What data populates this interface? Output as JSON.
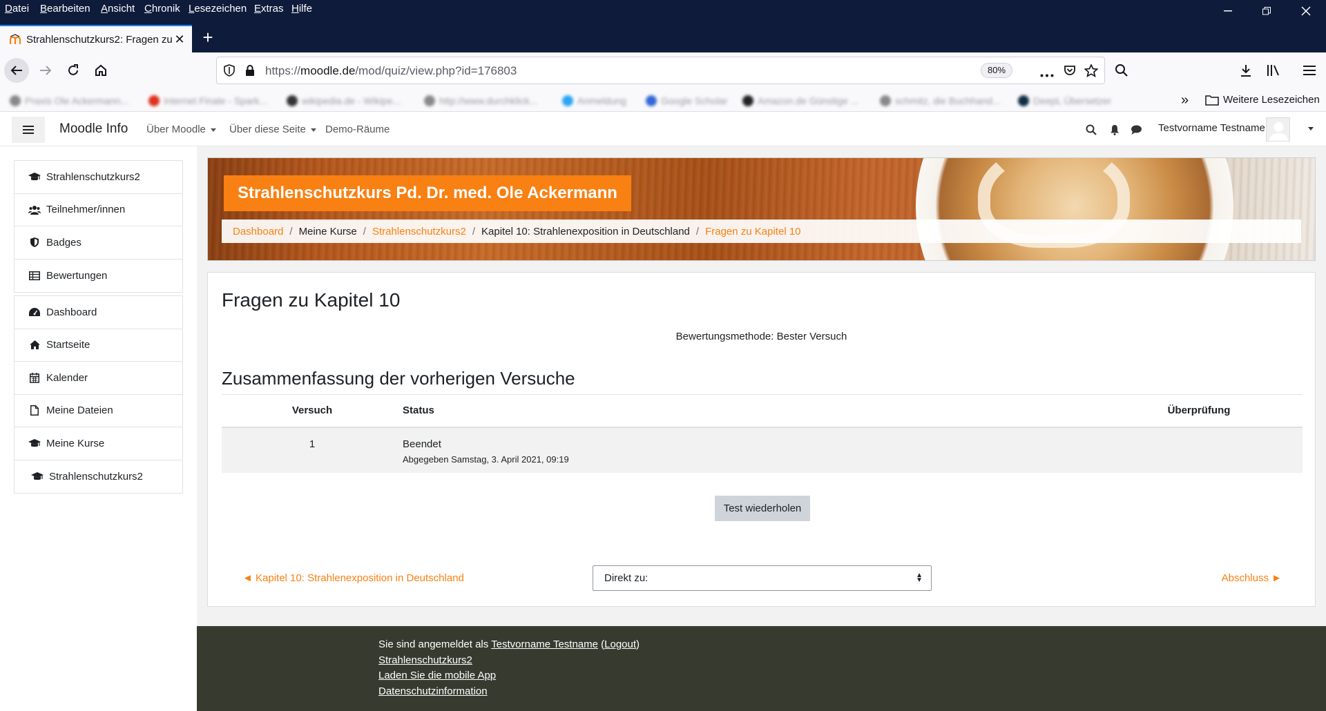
{
  "browser": {
    "menu": [
      "Datei",
      "Bearbeiten",
      "Ansicht",
      "Chronik",
      "Lesezeichen",
      "Extras",
      "Hilfe"
    ],
    "tab_title": "Strahlenschutzkurs2: Fragen zu Kapitel 10",
    "url_prefix": "https://",
    "url_host": "moodle.de",
    "url_path": "/mod/quiz/view.php?id=176803",
    "zoom": "80%",
    "bookmarks": [
      "Praxis Ole Ackermann...",
      "Internet Finale - Spark...",
      "wikipedia.de - Wikipe...",
      "http://www.durchklick...",
      "Anmeldung",
      "Google Scholar",
      "Amazon.de Günstige ...",
      "schmitz, die Buchhand...",
      "DeepL Übersetzer"
    ],
    "bookmarks_more": "Weitere Lesezeichen"
  },
  "moodle_nav": {
    "site_name": "Moodle Info",
    "menu1": "Über Moodle",
    "menu2": "Über diese Seite",
    "menu3": "Demo-Räume",
    "user": "Testvorname Testname"
  },
  "drawer": {
    "group1": [
      "Strahlenschutzkurs2",
      "Teilnehmer/innen",
      "Badges",
      "Bewertungen"
    ],
    "group2": [
      "Dashboard",
      "Startseite",
      "Kalender",
      "Meine Dateien",
      "Meine Kurse",
      "Strahlenschutzkurs2"
    ]
  },
  "header": {
    "course_title": "Strahlenschutzkurs Pd. Dr. med. Ole Ackermann",
    "breadcrumb": [
      "Dashboard",
      "Meine Kurse",
      "Strahlenschutzkurs2",
      "Kapitel 10: Strahlenexposition in Deutschland",
      "Fragen zu Kapitel 10"
    ]
  },
  "main": {
    "title": "Fragen zu Kapitel 10",
    "grading_method": "Bewertungsmethode: Bester Versuch",
    "summary_title": "Zusammenfassung der vorherigen Versuche",
    "columns": [
      "Versuch",
      "Status",
      "Überprüfung"
    ],
    "rows": [
      {
        "attempt": "1",
        "status": "Beendet",
        "submitted": "Abgegeben Samstag, 3. April 2021, 09:19",
        "review": ""
      }
    ],
    "retake_label": "Test wiederholen",
    "prev_link": "◄ Kapitel 10: Strahlenexposition in Deutschland",
    "jump_label": "Direkt zu:",
    "next_link": "Abschluss ►"
  },
  "footer": {
    "logged_in_as": "Sie sind angemeldet als ",
    "user": "Testvorname Testname",
    "logout": "Logout",
    "course_link": "Strahlenschutzkurs2",
    "app_link": "Laden Sie die mobile App",
    "privacy_link": "Datenschutzinformation"
  },
  "colors": {
    "accent": "#f98012",
    "footer_bg": "#373a2f",
    "browser_dark": "#0f1b3b"
  }
}
